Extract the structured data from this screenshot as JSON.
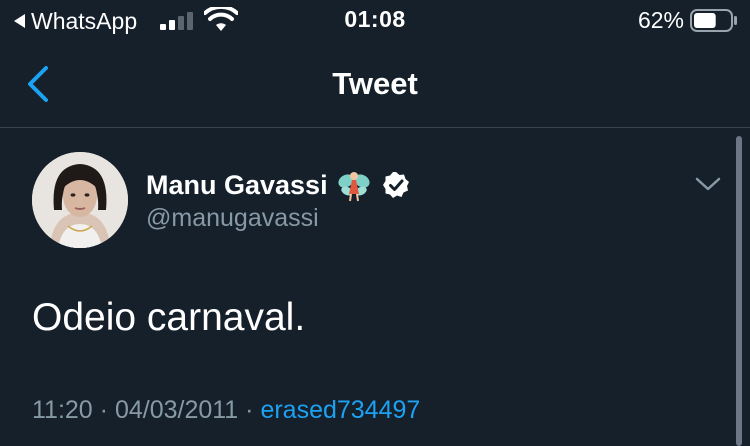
{
  "status_bar": {
    "back_app": "WhatsApp",
    "time": "01:08",
    "battery_percent": "62%",
    "battery_level": 0.62,
    "signal_bars": 2,
    "icons": [
      "back-triangle-icon",
      "signal-icon",
      "wifi-icon",
      "battery-icon"
    ]
  },
  "nav": {
    "title": "Tweet",
    "back_icon": "chevron-left-icon",
    "accent": "#1da1f2"
  },
  "tweet": {
    "author_name": "Manu Gavassi",
    "author_emoji_icon": "fairy-icon",
    "verified_icon": "verified-badge-icon",
    "handle": "@manugavassi",
    "text": "Odeio carnaval.",
    "time": "11:20",
    "separator": " · ",
    "date": "04/03/2011",
    "source": "erased734497",
    "menu_icon": "chevron-down-icon"
  },
  "colors": {
    "background": "#15202b",
    "secondary_text": "#8899a6",
    "link": "#1da1f2",
    "divider": "#38444d"
  }
}
